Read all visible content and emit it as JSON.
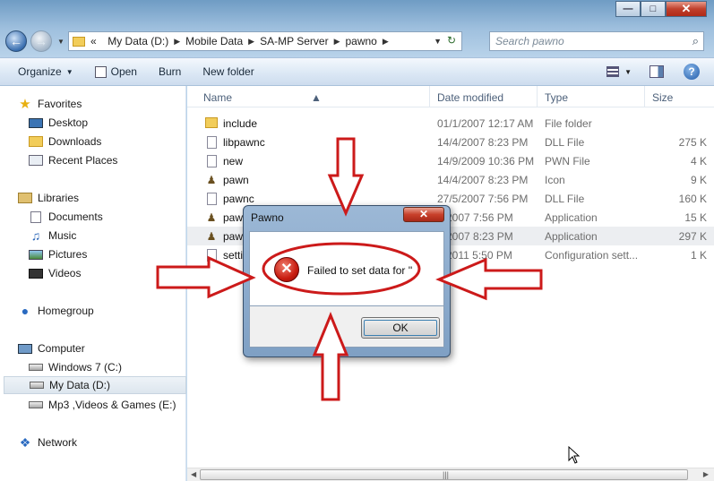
{
  "window": {
    "minimize": "—",
    "maximize": "□",
    "close": "✕"
  },
  "address": {
    "back_icon": "back-arrow-icon",
    "forward_icon": "forward-arrow-icon",
    "overflow": "«",
    "crumbs": [
      "My Data (D:)",
      "Mobile Data",
      "SA-MP Server",
      "pawno"
    ],
    "search_placeholder": "Search pawno"
  },
  "toolbar": {
    "organize": "Organize",
    "open": "Open",
    "burn": "Burn",
    "new_folder": "New folder"
  },
  "nav": {
    "favorites": "Favorites",
    "desktop": "Desktop",
    "downloads": "Downloads",
    "recent": "Recent Places",
    "libraries": "Libraries",
    "documents": "Documents",
    "music": "Music",
    "pictures": "Pictures",
    "videos": "Videos",
    "homegroup": "Homegroup",
    "computer": "Computer",
    "drive_c": "Windows 7 (C:)",
    "drive_d": "My Data (D:)",
    "drive_e": "Mp3 ,Videos & Games (E:)",
    "network": "Network"
  },
  "columns": {
    "name": "Name",
    "date": "Date modified",
    "type": "Type",
    "size": "Size"
  },
  "files": [
    {
      "name": "include",
      "date": "01/1/2007 12:17 AM",
      "type": "File folder",
      "size": ""
    },
    {
      "name": "libpawnc",
      "date": "14/4/2007 8:23 PM",
      "type": "DLL File",
      "size": "275 K"
    },
    {
      "name": "new",
      "date": "14/9/2009 10:36 PM",
      "type": "PWN File",
      "size": "4 K"
    },
    {
      "name": "pawn",
      "date": "14/4/2007 8:23 PM",
      "type": "Icon",
      "size": "9 K"
    },
    {
      "name": "pawnc",
      "date": "27/5/2007 7:56 PM",
      "type": "DLL File",
      "size": "160 K"
    },
    {
      "name": "pawn",
      "date": "5/2007 7:56 PM",
      "type": "Application",
      "size": "15 K"
    },
    {
      "name": "paw",
      "date": "4/2007 8:23 PM",
      "type": "Application",
      "size": "297 K"
    },
    {
      "name": "setti",
      "date": "1/2011 5:50 PM",
      "type": "Configuration sett...",
      "size": "1 K"
    }
  ],
  "dialog": {
    "title": "Pawno",
    "close": "✕",
    "icon": "error-icon",
    "message": "Failed to set data for ''",
    "ok": "OK"
  },
  "annotation": {
    "color": "#cc1a1a",
    "arrow_count": 4,
    "circle": "ellipse around error message"
  }
}
